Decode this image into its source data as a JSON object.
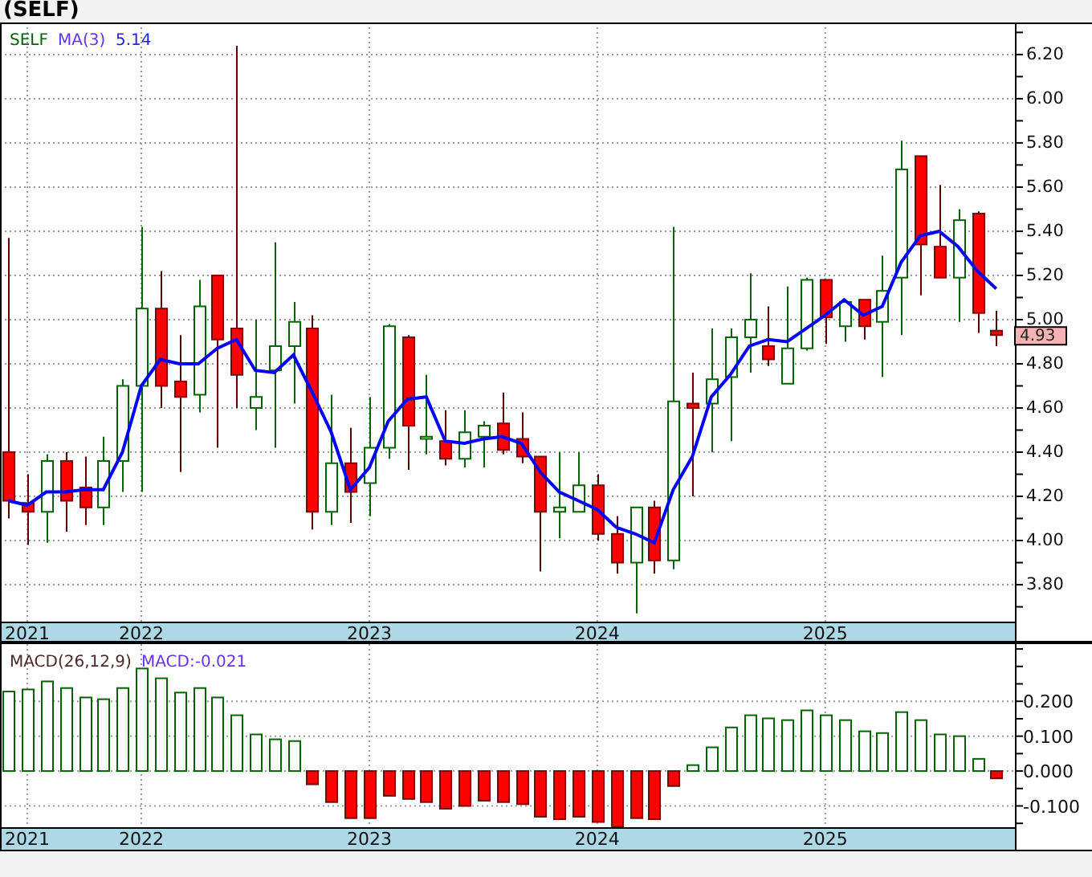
{
  "title": "(SELF)",
  "price_panel": {
    "legend": {
      "symbol": "SELF",
      "value": "5.14"
    },
    "last_price": "4.93",
    "chart_data": {
      "type": "candlestick",
      "grid": true,
      "xlim": [
        2021.38,
        2025.832
      ],
      "ylim": [
        3.633,
        6.345
      ],
      "x": [
        2021.417,
        2021.5,
        2021.583,
        2021.667,
        2021.75,
        2021.833,
        2021.917,
        2022,
        2022.083,
        2022.167,
        2022.25,
        2022.333,
        2022.417,
        2022.5,
        2022.583,
        2022.667,
        2022.75,
        2022.833,
        2022.917,
        2023,
        2023.083,
        2023.167,
        2023.25,
        2023.333,
        2023.417,
        2023.5,
        2023.583,
        2023.667,
        2023.75,
        2023.833,
        2023.917,
        2024,
        2024.083,
        2024.167,
        2024.25,
        2024.333,
        2024.417,
        2024.5,
        2024.583,
        2024.667,
        2024.75,
        2024.833,
        2024.917,
        2025,
        2025.083,
        2025.167,
        2025.25,
        2025.333,
        2025.417,
        2025.5,
        2025.583,
        2025.667,
        2025.75
      ],
      "xticks": [
        {
          "value": 2021.5,
          "label": "2021"
        },
        {
          "value": 2022,
          "label": "2022"
        },
        {
          "value": 2023,
          "label": "2023"
        },
        {
          "value": 2024,
          "label": "2024"
        },
        {
          "value": 2025,
          "label": "2025"
        }
      ],
      "yticks": [
        {
          "value": 3.8,
          "label": "3.80"
        },
        {
          "value": 4.0,
          "label": "4.00"
        },
        {
          "value": 4.2,
          "label": "4.20"
        },
        {
          "value": 4.4,
          "label": "4.40"
        },
        {
          "value": 4.6,
          "label": "4.60"
        },
        {
          "value": 4.8,
          "label": "4.80"
        },
        {
          "value": 5.0,
          "label": "5.00"
        },
        {
          "value": 5.2,
          "label": "5.20"
        },
        {
          "value": 5.4,
          "label": "5.40"
        },
        {
          "value": 5.6,
          "label": "5.60"
        },
        {
          "value": 5.8,
          "label": "5.80"
        },
        {
          "value": 6.0,
          "label": "6.00"
        },
        {
          "value": 6.2,
          "label": "6.20"
        }
      ],
      "ohlc": [
        [
          4.4,
          5.37,
          4.1,
          4.18
        ],
        [
          4.17,
          4.3,
          3.98,
          4.13
        ],
        [
          4.13,
          4.39,
          3.99,
          4.36
        ],
        [
          4.36,
          4.4,
          4.04,
          4.18
        ],
        [
          4.24,
          4.38,
          4.07,
          4.15
        ],
        [
          4.15,
          4.47,
          4.07,
          4.36
        ],
        [
          4.36,
          4.73,
          4.22,
          4.7
        ],
        [
          4.7,
          5.42,
          4.22,
          5.05
        ],
        [
          5.05,
          5.22,
          4.6,
          4.7
        ],
        [
          4.72,
          4.93,
          4.31,
          4.65
        ],
        [
          4.66,
          5.18,
          4.58,
          5.06
        ],
        [
          5.2,
          5.2,
          4.42,
          4.91
        ],
        [
          4.96,
          6.24,
          4.6,
          4.75
        ],
        [
          4.6,
          5.0,
          4.5,
          4.65
        ],
        [
          4.77,
          5.35,
          4.42,
          4.88
        ],
        [
          4.88,
          5.08,
          4.62,
          4.99
        ],
        [
          4.96,
          5.02,
          4.05,
          4.13
        ],
        [
          4.13,
          4.66,
          4.07,
          4.35
        ],
        [
          4.35,
          4.51,
          4.08,
          4.22
        ],
        [
          4.26,
          4.65,
          4.11,
          4.42
        ],
        [
          4.42,
          4.98,
          4.37,
          4.97
        ],
        [
          4.92,
          4.93,
          4.32,
          4.52
        ],
        [
          4.46,
          4.75,
          4.39,
          4.47
        ],
        [
          4.45,
          4.59,
          4.34,
          4.37
        ],
        [
          4.37,
          4.59,
          4.33,
          4.49
        ],
        [
          4.47,
          4.54,
          4.33,
          4.52
        ],
        [
          4.53,
          4.67,
          4.39,
          4.41
        ],
        [
          4.46,
          4.58,
          4.35,
          4.38
        ],
        [
          4.38,
          4.38,
          3.86,
          4.13
        ],
        [
          4.13,
          4.4,
          4.01,
          4.15
        ],
        [
          4.13,
          4.4,
          4.13,
          4.25
        ],
        [
          4.25,
          4.3,
          4.0,
          4.03
        ],
        [
          4.03,
          4.11,
          3.85,
          3.9
        ],
        [
          3.9,
          4.15,
          3.67,
          4.15
        ],
        [
          4.15,
          4.18,
          3.85,
          3.91
        ],
        [
          3.91,
          5.42,
          3.87,
          4.63
        ],
        [
          4.62,
          4.76,
          4.2,
          4.6
        ],
        [
          4.62,
          4.96,
          4.4,
          4.73
        ],
        [
          4.74,
          4.96,
          4.45,
          4.92
        ],
        [
          4.92,
          5.21,
          4.76,
          5.0
        ],
        [
          4.88,
          5.06,
          4.79,
          4.82
        ],
        [
          4.71,
          5.15,
          4.71,
          4.87
        ],
        [
          4.87,
          5.19,
          4.86,
          5.18
        ],
        [
          5.18,
          5.18,
          4.89,
          5.01
        ],
        [
          4.97,
          5.09,
          4.9,
          5.08
        ],
        [
          5.09,
          5.09,
          4.91,
          4.97
        ],
        [
          4.99,
          5.29,
          4.74,
          5.13
        ],
        [
          5.19,
          5.81,
          4.93,
          5.68
        ],
        [
          5.74,
          5.74,
          5.11,
          5.34
        ],
        [
          5.33,
          5.61,
          5.19,
          5.19
        ],
        [
          5.19,
          5.5,
          4.99,
          5.45
        ],
        [
          5.48,
          5.49,
          4.94,
          5.03
        ],
        [
          4.95,
          5.04,
          4.88,
          4.93
        ]
      ],
      "series": [
        {
          "name": "MA(3)",
          "type": "line",
          "values": [
            4.18,
            4.16,
            4.22,
            4.22,
            4.23,
            4.23,
            4.4,
            4.7,
            4.82,
            4.8,
            4.8,
            4.87,
            4.91,
            4.77,
            4.76,
            4.84,
            4.67,
            4.49,
            4.23,
            4.33,
            4.54,
            4.64,
            4.65,
            4.45,
            4.44,
            4.46,
            4.47,
            4.44,
            4.31,
            4.22,
            4.18,
            4.14,
            4.06,
            4.03,
            3.99,
            4.23,
            4.38,
            4.65,
            4.75,
            4.88,
            4.91,
            4.9,
            4.96,
            5.02,
            5.09,
            5.02,
            5.06,
            5.26,
            5.38,
            5.4,
            5.33,
            5.22,
            5.14
          ]
        }
      ]
    }
  },
  "macd_panel": {
    "legend": {
      "indicator": "MACD(26,12,9)",
      "value": "MACD:-0.021"
    },
    "chart_data": {
      "type": "bar",
      "grid": true,
      "xlim": [
        2021.38,
        2025.832
      ],
      "ylim": [
        -0.161,
        0.364
      ],
      "x": [
        2021.417,
        2021.5,
        2021.583,
        2021.667,
        2021.75,
        2021.833,
        2021.917,
        2022,
        2022.083,
        2022.167,
        2022.25,
        2022.333,
        2022.417,
        2022.5,
        2022.583,
        2022.667,
        2022.75,
        2022.833,
        2022.917,
        2023,
        2023.083,
        2023.167,
        2023.25,
        2023.333,
        2023.417,
        2023.5,
        2023.583,
        2023.667,
        2023.75,
        2023.833,
        2023.917,
        2024,
        2024.083,
        2024.167,
        2024.25,
        2024.333,
        2024.417,
        2024.5,
        2024.583,
        2024.667,
        2024.75,
        2024.833,
        2024.917,
        2025,
        2025.083,
        2025.167,
        2025.25,
        2025.333,
        2025.417,
        2025.5,
        2025.583,
        2025.667,
        2025.75
      ],
      "xticks": [
        {
          "value": 2021.5,
          "label": "2021"
        },
        {
          "value": 2022,
          "label": "2022"
        },
        {
          "value": 2023,
          "label": "2023"
        },
        {
          "value": 2024,
          "label": "2024"
        },
        {
          "value": 2025,
          "label": "2025"
        }
      ],
      "yticks": [
        {
          "value": -0.1,
          "label": "-0.100"
        },
        {
          "value": 0,
          "label": "0.000"
        },
        {
          "value": 0.1,
          "label": "0.100"
        },
        {
          "value": 0.2,
          "label": "0.200"
        }
      ],
      "values": [
        0.228,
        0.234,
        0.257,
        0.238,
        0.211,
        0.206,
        0.238,
        0.294,
        0.266,
        0.225,
        0.238,
        0.211,
        0.16,
        0.105,
        0.091,
        0.086,
        -0.038,
        -0.089,
        -0.135,
        -0.135,
        -0.071,
        -0.08,
        -0.089,
        -0.108,
        -0.1,
        -0.085,
        -0.089,
        -0.095,
        -0.131,
        -0.138,
        -0.131,
        -0.146,
        -0.16,
        -0.135,
        -0.138,
        -0.043,
        0.017,
        0.068,
        0.125,
        0.16,
        0.151,
        0.146,
        0.174,
        0.16,
        0.146,
        0.114,
        0.109,
        0.169,
        0.146,
        0.105,
        0.1,
        0.035,
        -0.021
      ]
    }
  }
}
